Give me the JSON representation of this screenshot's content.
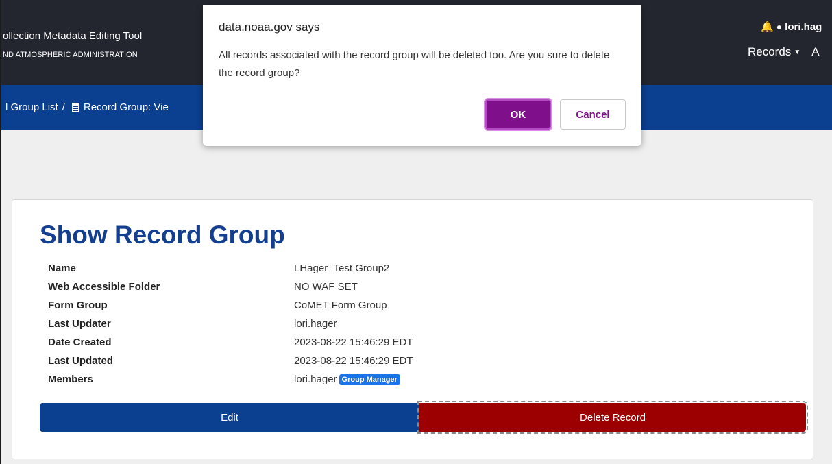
{
  "header": {
    "app_title": "ollection Metadata Editing Tool",
    "app_subtitle": "ND ATMOSPHERIC ADMINISTRATION",
    "user_name": "lori.hag",
    "nav_records": "Records",
    "nav_next": "A",
    "bell_icon": "bell-icon",
    "user_icon": "user-icon"
  },
  "breadcrumb": {
    "item1": "l Group List",
    "separator": "/",
    "item2": "Record Group: Vie",
    "doc_icon": "document-icon"
  },
  "card": {
    "title": "Show Record Group",
    "fields": [
      {
        "label": "Name",
        "value": "LHager_Test Group2"
      },
      {
        "label": "Web Accessible Folder",
        "value": "NO WAF SET"
      },
      {
        "label": "Form Group",
        "value": "CoMET Form Group"
      },
      {
        "label": "Last Updater",
        "value": "lori.hager"
      },
      {
        "label": "Date Created",
        "value": "2023-08-22 15:46:29 EDT"
      },
      {
        "label": "Last Updated",
        "value": "2023-08-22 15:46:29 EDT"
      },
      {
        "label": "Members",
        "value": "lori.hager"
      }
    ],
    "member_badge": "Group Manager",
    "edit_label": "Edit",
    "delete_label": "Delete Record"
  },
  "dialog": {
    "title": "data.noaa.gov says",
    "message": "All records associated with the record group will be deleted too. Are you sure to delete the record group?",
    "ok_label": "OK",
    "cancel_label": "Cancel"
  },
  "colors": {
    "header_bg": "#23262f",
    "breadcrumb_bg": "#0b3f8f",
    "title_color": "#143e8e",
    "delete_bg": "#9c0000",
    "ok_bg": "#800f8b",
    "badge_bg": "#1a73e8",
    "bell": "#f5b417"
  }
}
